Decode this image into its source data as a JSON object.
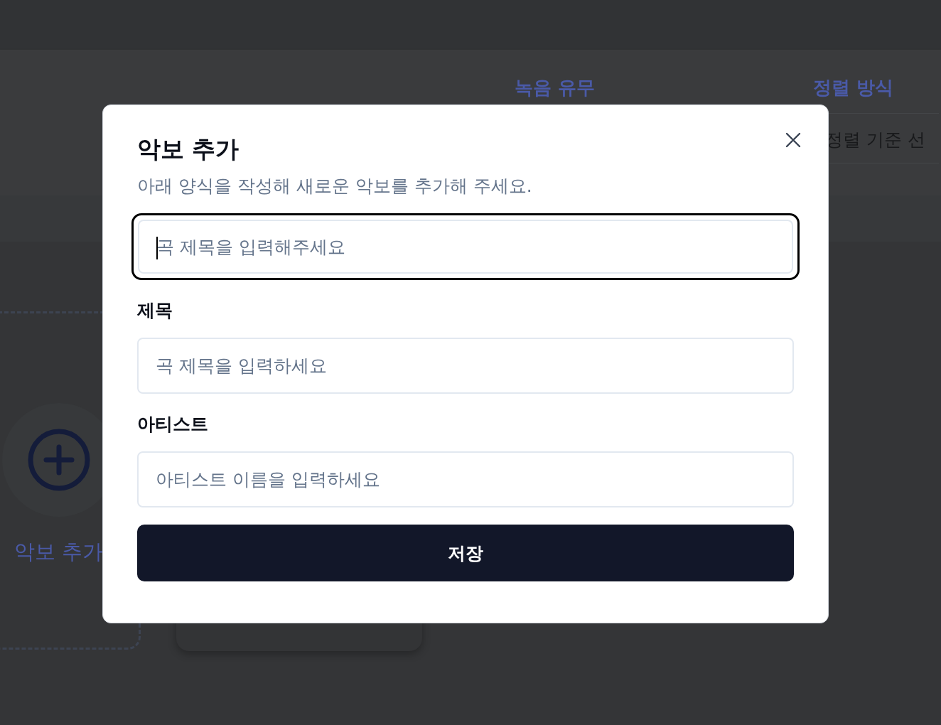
{
  "background": {
    "filter_labels": [
      "녹음 유무",
      "정렬 방식"
    ],
    "sort_select": {
      "value": "정렬 기준 선"
    },
    "add_card": {
      "label": "악보 추가"
    }
  },
  "dialog": {
    "title": "악보 추가",
    "description": "아래 양식을 작성해 새로운 악보를 추가해 주세요.",
    "search": {
      "placeholder": "곡 제목을 입력해주세요",
      "focused": true
    },
    "fields": [
      {
        "label": "제목",
        "placeholder": "곡 제목을 입력하세요"
      },
      {
        "label": "아티스트",
        "placeholder": "아티스트 이름을 입력하세요"
      }
    ],
    "save_button": "저장"
  }
}
